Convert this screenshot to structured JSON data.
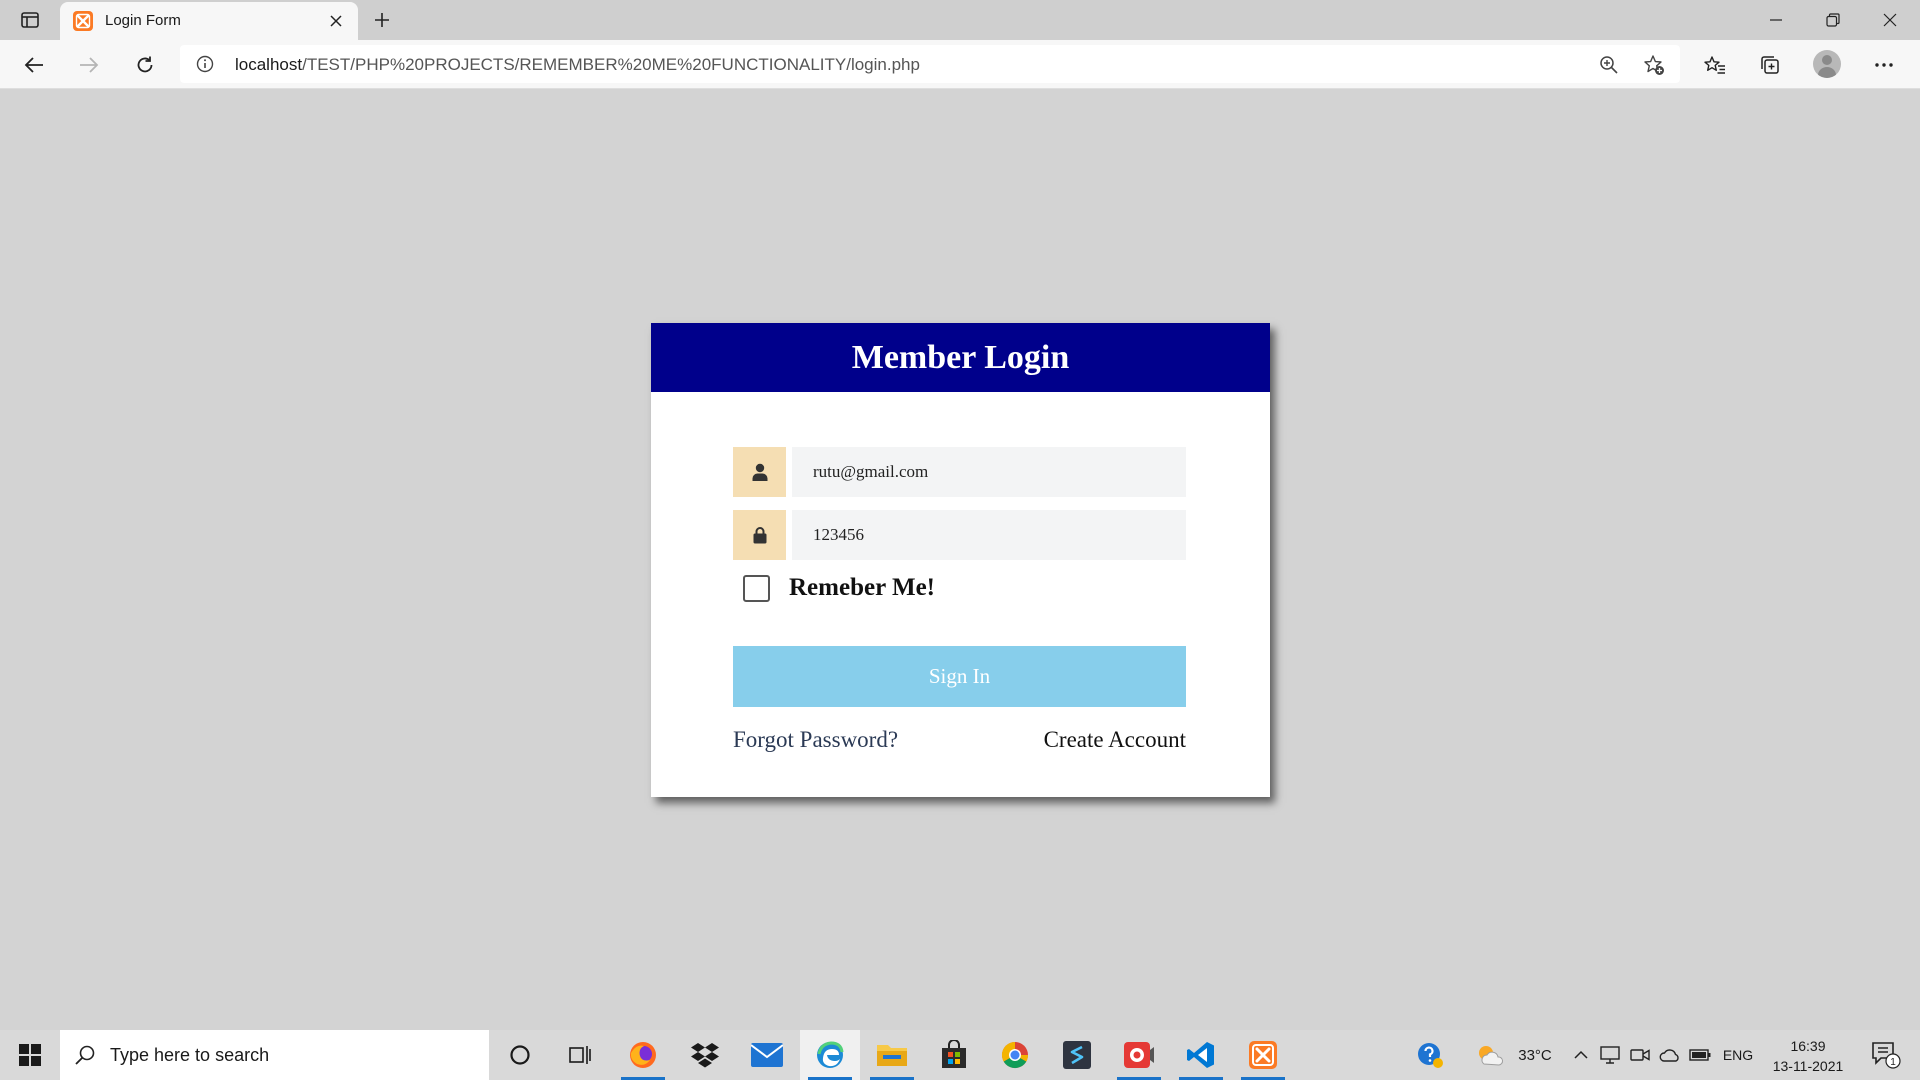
{
  "browser": {
    "tab": {
      "title": "Login Form",
      "favicon": "xampp-icon"
    },
    "address": {
      "host": "localhost",
      "path": "/TEST/PHP%20PROJECTS/REMEMBER%20ME%20FUNCTIONALITY/login.php"
    },
    "colors": {
      "tabstrip": "#cfcfcf",
      "toolbar": "#f7f7f7",
      "page_bg": "#d3d3d3"
    }
  },
  "login": {
    "title": "Member Login",
    "email_value": "rutu@gmail.com",
    "password_value": "123456",
    "remember_label": "Remeber Me!",
    "remember_checked": false,
    "signin_label": "Sign In",
    "forgot_label": "Forgot Password?",
    "create_label": "Create Account",
    "colors": {
      "header": "#00008b",
      "icon_bg": "#f5deb3",
      "input_bg": "#f3f4f5",
      "button": "#87ceeb"
    }
  },
  "taskbar": {
    "search_placeholder": "Type here to search",
    "apps": [
      "cortana-icon",
      "task-view-icon",
      "firefox-icon",
      "dropbox-icon",
      "mail-icon",
      "edge-icon",
      "file-explorer-icon",
      "store-icon",
      "chrome-icon",
      "sublime-icon",
      "screen-recorder-icon",
      "vscode-icon",
      "xampp-icon"
    ],
    "weather": "33°C",
    "language": "ENG",
    "time": "16:39",
    "date": "13-11-2021",
    "notification_count": "1"
  }
}
